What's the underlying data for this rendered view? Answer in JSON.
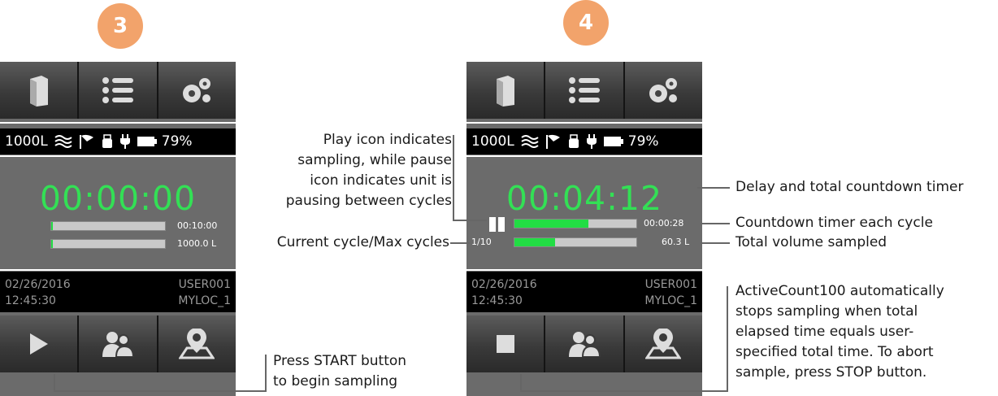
{
  "steps": [
    "3",
    "4"
  ],
  "left_screen": {
    "status": {
      "volume": "1000L",
      "battery_pct": "79%"
    },
    "timer": "00:00:00",
    "bars": [
      {
        "value": "00:10:00",
        "fill": 0.01
      },
      {
        "value": "1000.0 L",
        "fill": 0.01
      }
    ],
    "info": {
      "date": "02/26/2016",
      "time": "12:45:30",
      "user": "USER001",
      "location": "MYLOC_1"
    },
    "bottom_buttons": [
      "play-icon",
      "users-icon",
      "map-pin-icon"
    ]
  },
  "right_screen": {
    "status": {
      "volume": "1000L",
      "battery_pct": "79%"
    },
    "timer": "00:04:12",
    "cycle_label": "1/10",
    "bars": [
      {
        "value": "00:00:28",
        "fill": 0.6
      },
      {
        "value": "60.3 L",
        "fill": 0.33
      }
    ],
    "info": {
      "date": "02/26/2016",
      "time": "12:45:30",
      "user": "USER001",
      "location": "MYLOC_1"
    },
    "bottom_buttons": [
      "stop-icon",
      "users-icon",
      "map-pin-icon"
    ]
  },
  "toolbar_icons": [
    "book-icon",
    "list-icon",
    "gears-icon"
  ],
  "annotations": {
    "play_pause": [
      "Play icon indicates",
      "sampling, while pause",
      "icon indicates unit is",
      "pausing between cycles"
    ],
    "cycle": "Current cycle/Max cycles",
    "start": [
      "Press START button",
      "to begin sampling"
    ],
    "delay": "Delay and total countdown timer",
    "countdown": "Countdown timer each cycle",
    "volume": "Total volume sampled",
    "auto_stop": [
      "ActiveCount100 automatically",
      "stops sampling when total",
      "elapsed time equals user-",
      "specified total time.  To abort",
      "sample, press STOP button."
    ]
  },
  "colors": {
    "timer_green": "#33e055",
    "step_orange": "#f2a36b",
    "panel_gray": "#6b6b6b"
  }
}
